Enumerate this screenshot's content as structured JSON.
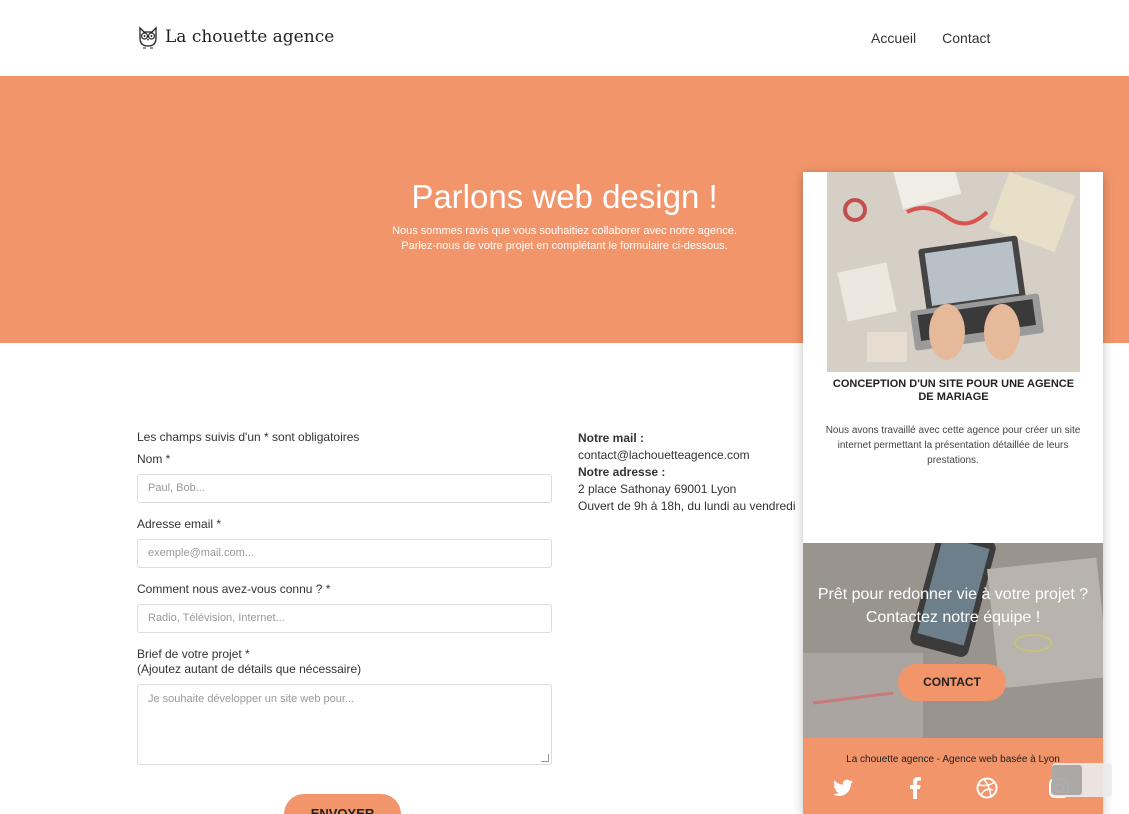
{
  "header": {
    "brand": "La chouette agence",
    "nav": [
      "Accueil",
      "Contact"
    ]
  },
  "hero": {
    "title": "Parlons web design !",
    "subtitle_line1": "Nous sommes ravis que vous souhaitiez collaborer avec notre agence.",
    "subtitle_line2": "Parlez-nous de votre projet en complétant le formulaire ci-dessous."
  },
  "form": {
    "required_note": "Les champs suivis d'un * sont obligatoires",
    "name_label": "Nom *",
    "name_placeholder": "Paul, Bob...",
    "email_label": "Adresse email *",
    "email_placeholder": "exemple@mail.com...",
    "source_label": "Comment nous avez-vous connu ? *",
    "source_placeholder": "Radio, Télévision, Internet...",
    "brief_label": "Brief de votre projet *",
    "brief_hint": "(Ajoutez autant de détails que nécessaire)",
    "brief_placeholder": "Je souhaite développer un site web pour...",
    "submit_label": "ENVOYER"
  },
  "contact": {
    "mail_label": "Notre mail :",
    "mail_value": "contact@lachouetteagence.com",
    "address_label": "Notre adresse :",
    "address_value": "2 place Sathonay 69001 Lyon",
    "hours": "Ouvert de 9h à 18h, du lundi au vendredi"
  },
  "card": {
    "title": "CONCEPTION D'UN SITE POUR UNE AGENCE DE MARIAGE",
    "text": "Nous avons travaillé avec cette agence pour créer un site internet permettant la présentation détaillée de leurs prestations.",
    "cta_line1": "Prêt pour redonner vie à votre projet ?",
    "cta_line2": "Contactez notre équipe !",
    "cta_button": "CONTACT",
    "footer_text": "La chouette agence - Agence web basée à Lyon",
    "socials": [
      "twitter-icon",
      "facebook-icon",
      "dribbble-icon",
      "instagram-icon"
    ]
  },
  "colors": {
    "accent": "#f2956b",
    "text": "#333333"
  }
}
